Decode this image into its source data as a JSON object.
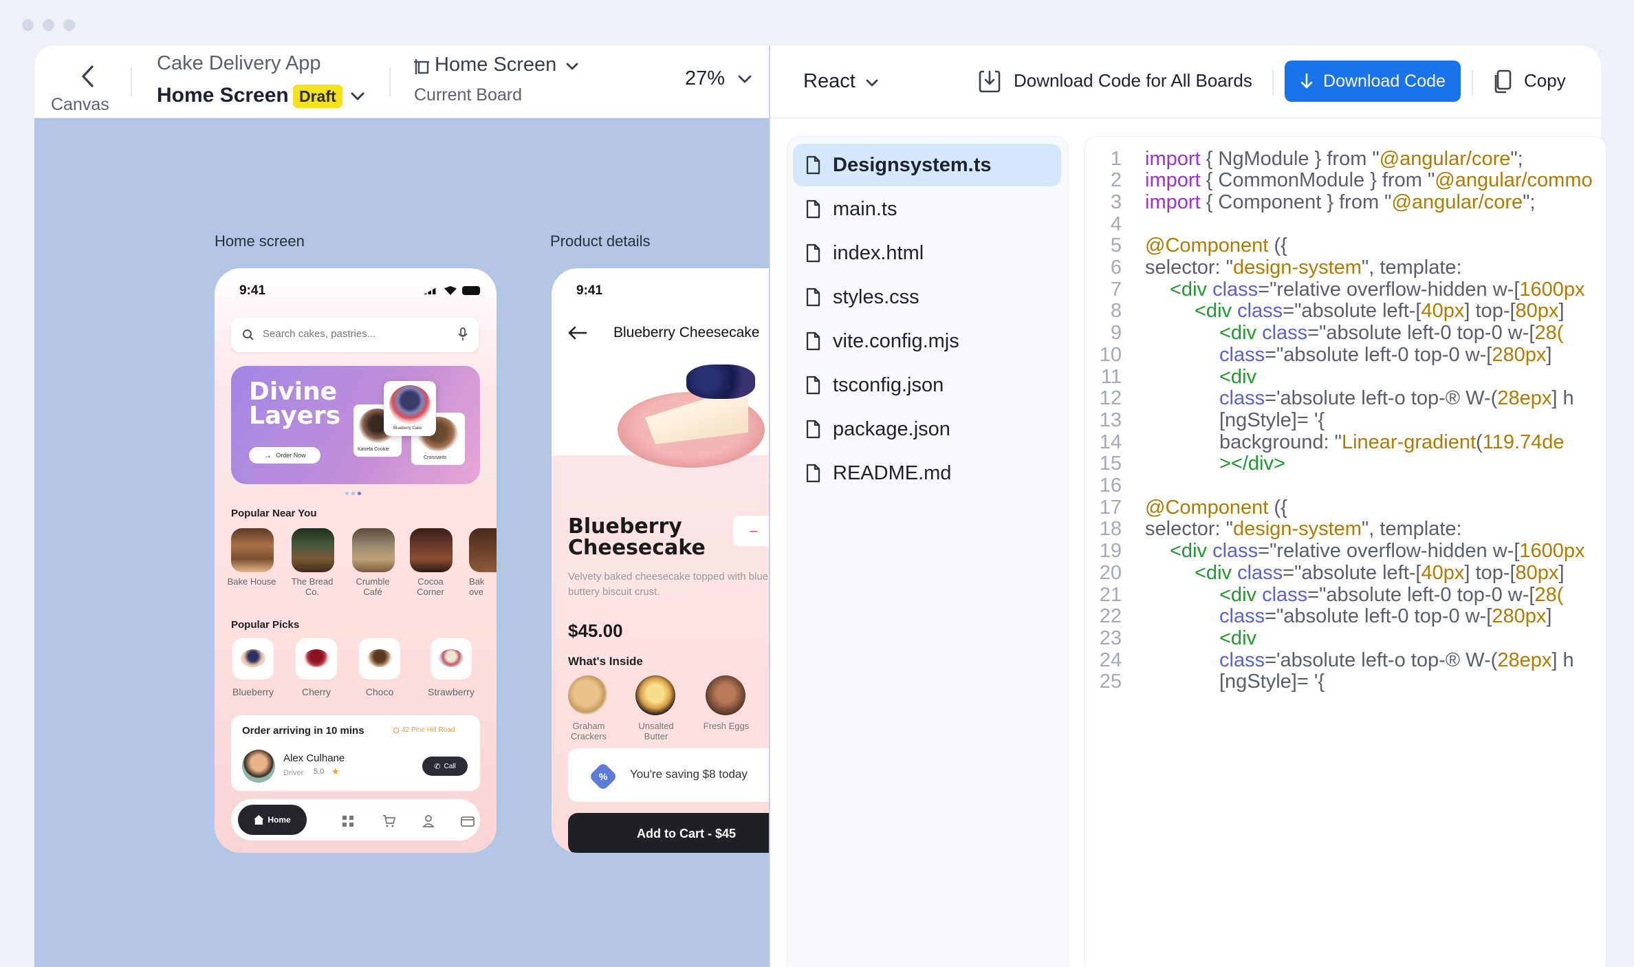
{
  "header": {
    "canvas_label": "Canvas",
    "app_title": "Cake Delivery App",
    "board_name": "Home Screen",
    "badge": "Draft",
    "board_selector": "Home Screen",
    "board_caption": "Current Board",
    "zoom": "27%"
  },
  "code_toolbar": {
    "framework": "React",
    "download_all": "Download Code for All Boards",
    "download": "Download Code",
    "copy": "Copy"
  },
  "files": [
    "Designsystem.ts",
    "main.ts",
    "index.html",
    "styles.css",
    "vite.config.mjs",
    "tsconfig.json",
    "package.json",
    "README.md"
  ],
  "canvas": {
    "home_label": "Home screen",
    "product_label": "Product details",
    "home": {
      "time": "9:41",
      "search_placeholder": "Search cakes, pastries...",
      "banner_title": "Divine Layers",
      "banner_button": "Order Now",
      "banner_card_1": "Blueberry Cake",
      "banner_card_2": "Kanefa Cookie",
      "banner_card_3": "Croissants",
      "popular_near": "Popular Near You",
      "shops": [
        "Bake House",
        "The Bread Co.",
        "Crumble Café",
        "Cocoa Corner",
        "Bak ove"
      ],
      "popular_picks": "Popular Picks",
      "picks": [
        "Blueberry",
        "Cherry",
        "Choco",
        "Strawberry"
      ],
      "order_title": "Order arriving in 10 mins",
      "order_address": "42 Pine Hill Road",
      "driver_name": "Alex Culhane",
      "driver_role": "Driver",
      "driver_rating": "5.0",
      "call": "Call",
      "nav_home": "Home"
    },
    "product": {
      "time": "9:41",
      "title_bar": "Blueberry Cheesecake",
      "name": "Blueberry Cheesecake",
      "qty_minus": "–",
      "description": "Velvety baked cheesecake topped with blueberries on a buttery biscuit crust.",
      "price": "$45.00",
      "whats_inside": "What's Inside",
      "ingredients": [
        "Graham Crackers",
        "Unsalted Butter",
        "Fresh Eggs"
      ],
      "saving": "You're saving $8 today",
      "add_to_cart": "Add to Cart - $45"
    }
  },
  "code_lines": [
    {
      "n": "1",
      "indent": 0,
      "parts": [
        [
          "kw",
          "import"
        ],
        [
          "plain",
          " { NgModule } from \""
        ],
        [
          "str",
          "@angular/core"
        ],
        [
          "plain",
          "\";"
        ]
      ]
    },
    {
      "n": "2",
      "indent": 0,
      "parts": [
        [
          "kw",
          "import"
        ],
        [
          "plain",
          " { CommonModule } from \""
        ],
        [
          "str",
          "@angular/commo"
        ]
      ]
    },
    {
      "n": "3",
      "indent": 0,
      "parts": [
        [
          "kw",
          "import"
        ],
        [
          "plain",
          " { Component } from \""
        ],
        [
          "str",
          "@angular/core"
        ],
        [
          "plain",
          "\";"
        ]
      ]
    },
    {
      "n": "4",
      "indent": 0,
      "parts": []
    },
    {
      "n": "5",
      "indent": 0,
      "parts": [
        [
          "str",
          "@Component"
        ],
        [
          "plain",
          " ({"
        ]
      ]
    },
    {
      "n": "6",
      "indent": 0,
      "parts": [
        [
          "plain",
          "selector: \""
        ],
        [
          "str",
          "design-system"
        ],
        [
          "plain",
          "\", template:"
        ]
      ]
    },
    {
      "n": "7",
      "indent": 1,
      "parts": [
        [
          "tag",
          "<div"
        ],
        [
          "attr",
          " class"
        ],
        [
          "plain",
          "=\"relative overflow-hidden w-["
        ],
        [
          "str",
          "1600px"
        ]
      ]
    },
    {
      "n": "8",
      "indent": 2,
      "parts": [
        [
          "tag",
          "<div"
        ],
        [
          "attr",
          " class"
        ],
        [
          "plain",
          "=\"absolute left-["
        ],
        [
          "str",
          "40px"
        ],
        [
          "plain",
          "] top-["
        ],
        [
          "str",
          "80px"
        ],
        [
          "plain",
          "]"
        ]
      ]
    },
    {
      "n": "9",
      "indent": 3,
      "parts": [
        [
          "tag",
          "<div"
        ],
        [
          "attr",
          " class"
        ],
        [
          "plain",
          "=\"absolute left-0 top-0 w-["
        ],
        [
          "str",
          "28("
        ]
      ]
    },
    {
      "n": "10",
      "indent": 3,
      "parts": [
        [
          "attr",
          "class"
        ],
        [
          "plain",
          "=\"absolute left-0 top-0 w-["
        ],
        [
          "str",
          "280px"
        ],
        [
          "plain",
          "]"
        ]
      ]
    },
    {
      "n": "11",
      "indent": 3,
      "parts": [
        [
          "tag",
          "<div"
        ]
      ]
    },
    {
      "n": "12",
      "indent": 3,
      "parts": [
        [
          "attr",
          "class"
        ],
        [
          "plain",
          "='absolute left-o top-® W-("
        ],
        [
          "str",
          "28epx"
        ],
        [
          "plain",
          "] h"
        ]
      ]
    },
    {
      "n": "13",
      "indent": 3,
      "parts": [
        [
          "plain",
          "[ngStyle]= '{"
        ]
      ]
    },
    {
      "n": "14",
      "indent": 3,
      "parts": [
        [
          "plain",
          "background: \""
        ],
        [
          "str",
          "Linear-gradient"
        ],
        [
          "plain",
          "("
        ],
        [
          "str",
          "119.74de"
        ]
      ]
    },
    {
      "n": "15",
      "indent": 3,
      "parts": [
        [
          "tag",
          "></div>"
        ]
      ]
    },
    {
      "n": "16",
      "indent": 0,
      "parts": []
    },
    {
      "n": "17",
      "indent": 0,
      "parts": [
        [
          "str",
          "@Component"
        ],
        [
          "plain",
          " ({"
        ]
      ]
    },
    {
      "n": "18",
      "indent": 0,
      "parts": [
        [
          "plain",
          "selector: \""
        ],
        [
          "str",
          "design-system"
        ],
        [
          "plain",
          "\", template:"
        ]
      ]
    },
    {
      "n": "19",
      "indent": 1,
      "parts": [
        [
          "tag",
          "<div"
        ],
        [
          "attr",
          " class"
        ],
        [
          "plain",
          "=\"relative overflow-hidden w-["
        ],
        [
          "str",
          "1600px"
        ]
      ]
    },
    {
      "n": "20",
      "indent": 2,
      "parts": [
        [
          "tag",
          "<div"
        ],
        [
          "attr",
          " class"
        ],
        [
          "plain",
          "=\"absolute left-["
        ],
        [
          "str",
          "40px"
        ],
        [
          "plain",
          "] top-["
        ],
        [
          "str",
          "80px"
        ],
        [
          "plain",
          "]"
        ]
      ]
    },
    {
      "n": "21",
      "indent": 3,
      "parts": [
        [
          "tag",
          "<div"
        ],
        [
          "attr",
          " class"
        ],
        [
          "plain",
          "=\"absolute left-0 top-0 w-["
        ],
        [
          "str",
          "28("
        ]
      ]
    },
    {
      "n": "22",
      "indent": 3,
      "parts": [
        [
          "attr",
          "class"
        ],
        [
          "plain",
          "=\"absolute left-0 top-0 w-["
        ],
        [
          "str",
          "280px"
        ],
        [
          "plain",
          "]"
        ]
      ]
    },
    {
      "n": "23",
      "indent": 3,
      "parts": [
        [
          "tag",
          "<div"
        ]
      ]
    },
    {
      "n": "24",
      "indent": 3,
      "parts": [
        [
          "attr",
          "class"
        ],
        [
          "plain",
          "='absolute left-o top-® W-("
        ],
        [
          "str",
          "28epx"
        ],
        [
          "plain",
          "] h"
        ]
      ]
    },
    {
      "n": "25",
      "indent": 3,
      "parts": [
        [
          "plain",
          "[ngStyle]= '{"
        ]
      ]
    }
  ],
  "colors": {
    "accent": "#1a73e8",
    "canvas_bg": "#b3c5e5",
    "draft_badge": "#f4e21c",
    "active_file": "#d6e6fb"
  }
}
